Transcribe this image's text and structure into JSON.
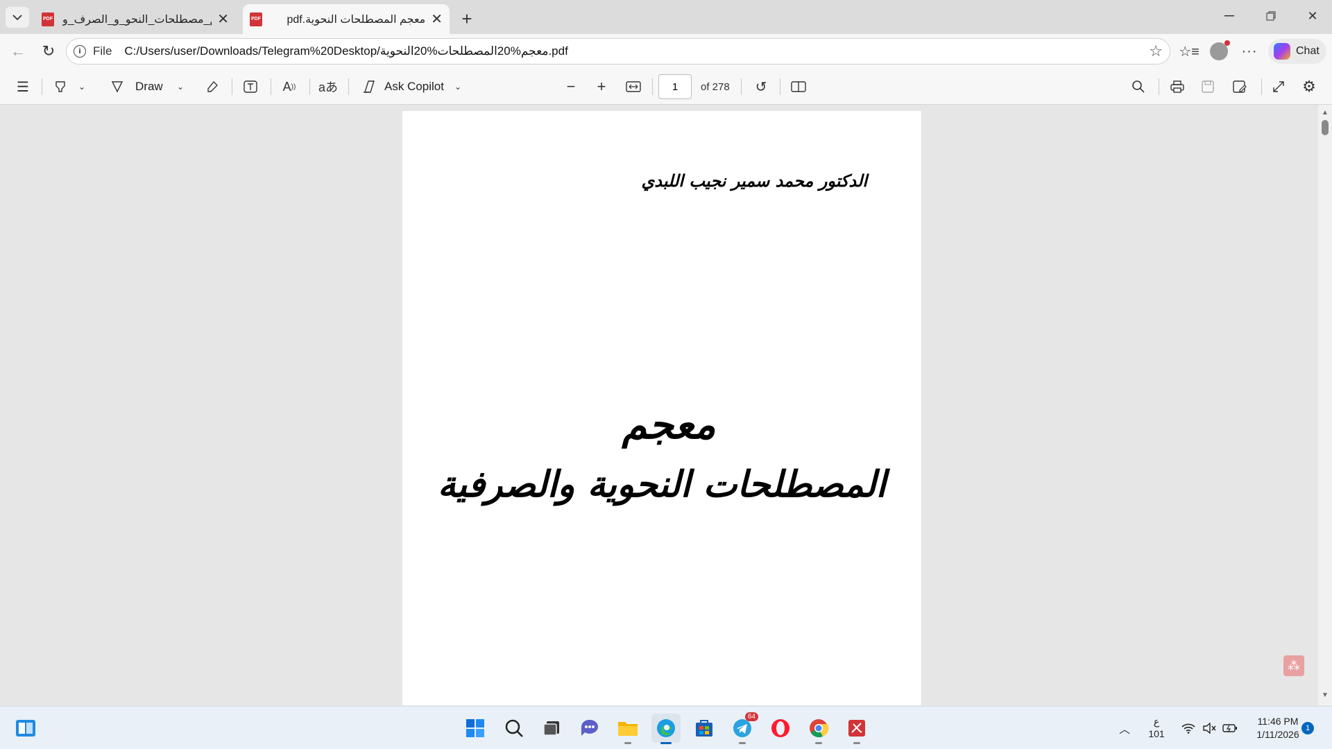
{
  "browser": {
    "tabs": [
      {
        "title": "معجم_مصطلحات_النحو_و_الصرف_و...",
        "icon": "pdf-icon"
      },
      {
        "title": "pdf.معجم المصطلحات النحوية",
        "icon": "pdf-icon",
        "active": true
      }
    ],
    "address": {
      "scheme": "File",
      "url": "C:/Users/user/Downloads/Telegram%20Desktop/معجم%20المصطلحات%20النحوية.pdf"
    },
    "chat_label": "Chat"
  },
  "pdf_toolbar": {
    "draw_label": "Draw",
    "ask_copilot_label": "Ask Copilot",
    "page_number": "1",
    "page_total": "of 278"
  },
  "document": {
    "author": "الدكتور محمد سمير نجيب اللبدي",
    "title_line1": "معجم",
    "title_line2": "المصطلحات النحوية والصرفية"
  },
  "taskbar": {
    "telegram_badge": "64",
    "lang_top": "ع",
    "lang_bottom": "101",
    "time": "11:46 PM",
    "date": "1/11/2026",
    "notification_count": "1"
  },
  "colors": {
    "accent": "#0067c0",
    "pdf_red": "#d13438"
  }
}
